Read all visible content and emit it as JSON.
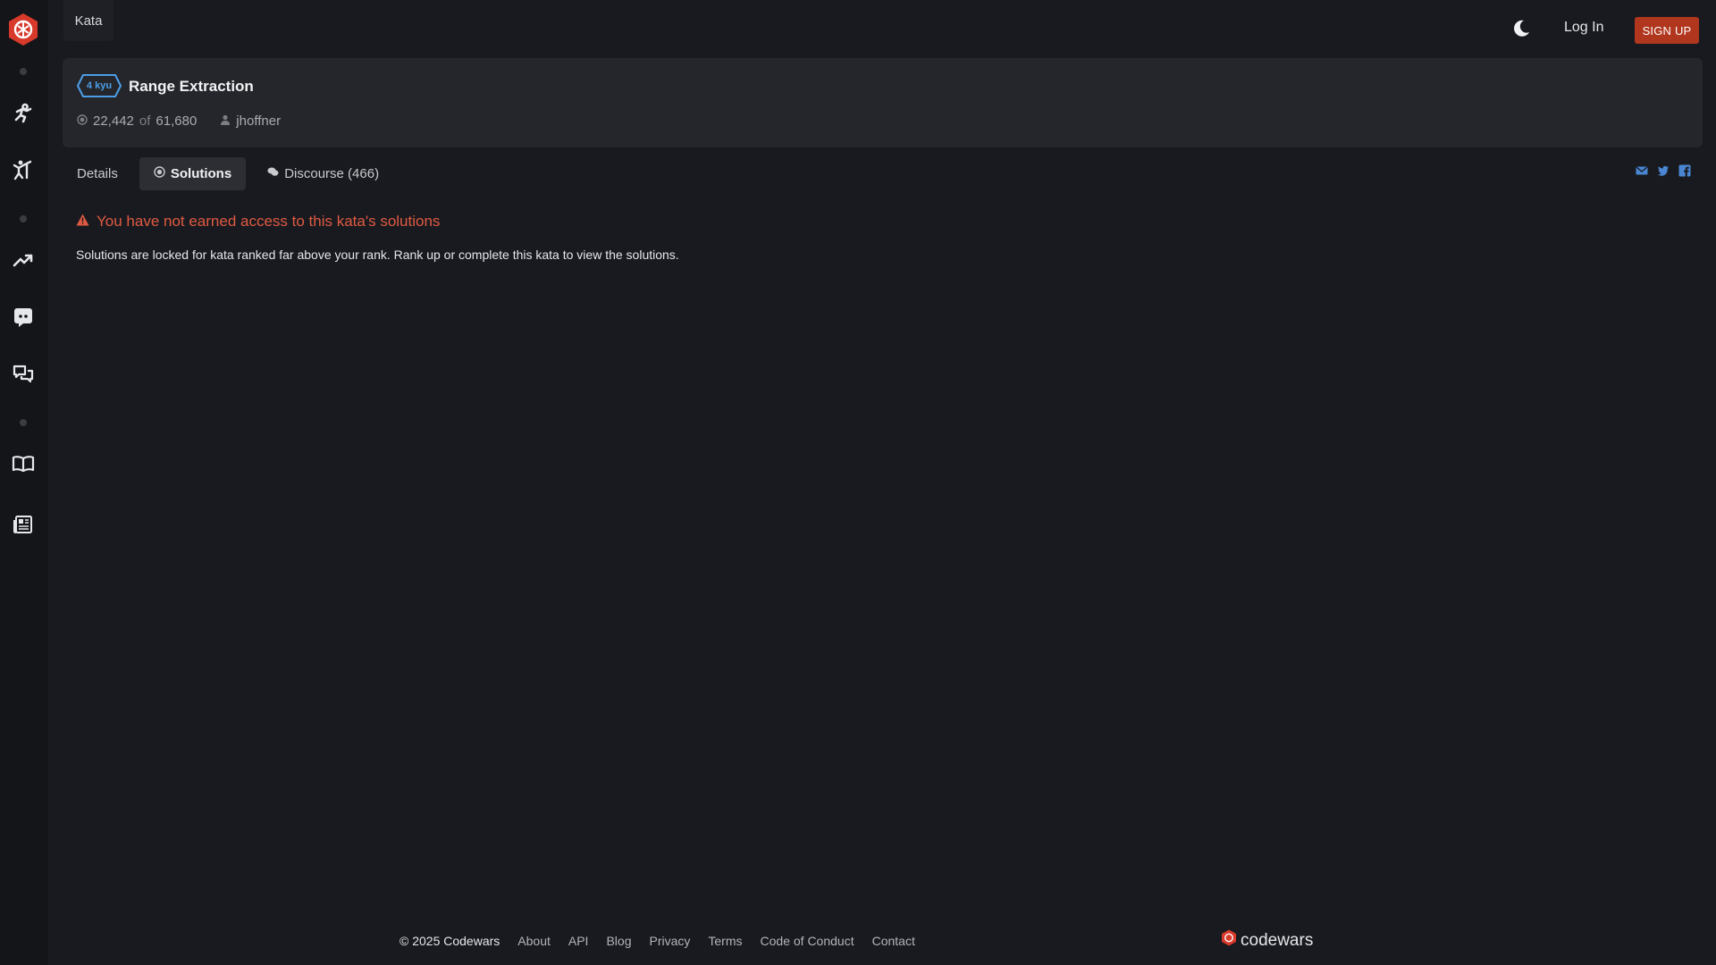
{
  "nav": {
    "kata_tab": "Kata",
    "login": "Log In",
    "signup": "SIGN UP"
  },
  "kata": {
    "rank": "4 kyu",
    "title": "Range Extraction",
    "completed": "22,442",
    "of": "of",
    "total": "61,680",
    "author": "jhoffner"
  },
  "tabs": [
    {
      "label": "Details"
    },
    {
      "label": "Solutions"
    },
    {
      "label": "Discourse (466)"
    }
  ],
  "alert": {
    "title": "You have not earned access to this kata's solutions",
    "body": "Solutions are locked for kata ranked far above your rank. Rank up or complete this kata to view the solutions."
  },
  "footer": {
    "copyright": "© 2025 Codewars",
    "links": [
      "About",
      "API",
      "Blog",
      "Privacy",
      "Terms",
      "Code of Conduct",
      "Contact"
    ],
    "logo_text": "codewars"
  },
  "colors": {
    "accent": "#b1361e",
    "rank_blue": "#4d9ee8",
    "alert_red": "#e05a42",
    "share_blue": "#4a86d1"
  },
  "icons": [
    "codewars-logo-icon",
    "training-icon",
    "practice-icon",
    "leaderboard-icon",
    "discord-icon",
    "discussions-icon",
    "docs-icon",
    "blog-icon",
    "moon-icon",
    "warning-icon",
    "email-icon",
    "twitter-icon",
    "facebook-icon"
  ]
}
